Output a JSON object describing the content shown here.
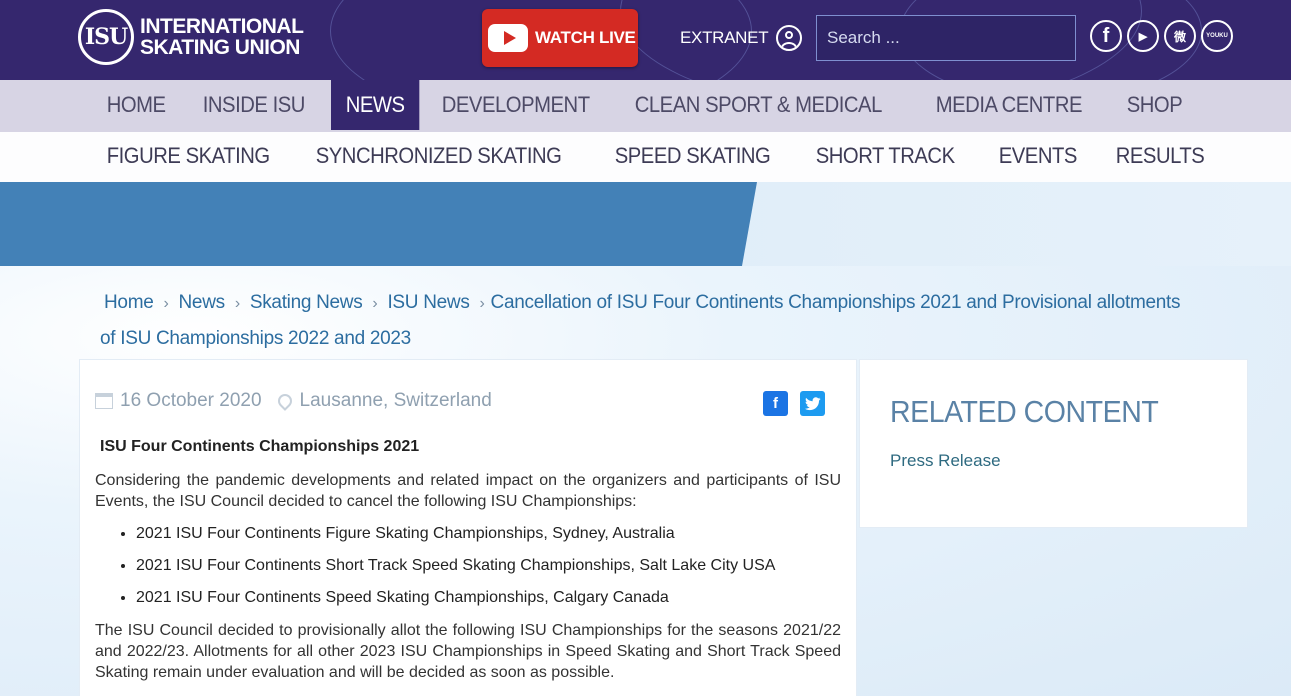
{
  "header": {
    "logo_mark": "ISU",
    "logo_line1": "INTERNATIONAL",
    "logo_line2": "SKATING UNION",
    "watch_live": "WATCH LIVE",
    "extranet": "EXTRANET",
    "search_placeholder": "Search ...",
    "social": [
      {
        "name": "facebook-icon",
        "glyph": "f"
      },
      {
        "name": "youtube-icon",
        "glyph": "▶"
      },
      {
        "name": "weibo-icon",
        "glyph": "微"
      },
      {
        "name": "youku-icon",
        "glyph": "YOUKU"
      }
    ]
  },
  "mainnav": [
    "HOME",
    "INSIDE ISU",
    "NEWS",
    "DEVELOPMENT",
    "CLEAN SPORT & MEDICAL",
    "MEDIA CENTRE",
    "SHOP"
  ],
  "mainnav_active": "NEWS",
  "subnav": [
    "FIGURE SKATING",
    "SYNCHRONIZED SKATING",
    "SPEED SKATING",
    "SHORT TRACK",
    "EVENTS",
    "RESULTS"
  ],
  "breadcrumb": {
    "items": [
      "Home",
      "News",
      "Skating News",
      "ISU News"
    ],
    "current": "Cancellation of ISU Four Continents Championships 2021 and Provisional allotments of ISU Championships 2022 and 2023"
  },
  "article": {
    "date": "16 October 2020",
    "location": "Lausanne, Switzerland",
    "share_facebook": "f",
    "share_twitter": "t",
    "heading": "ISU Four Continents Championships 2021",
    "intro": "Considering the pandemic developments and related impact on the organizers and participants of ISU Events, the ISU Council decided to cancel the following ISU Championships:",
    "events": [
      "2021 ISU Four Continents Figure Skating Championships, Sydney, Australia",
      "2021 ISU Four Continents Short Track Speed Skating Championships, Salt Lake City  USA",
      "2021 ISU Four Continents Speed Skating Championships, Calgary Canada"
    ],
    "allotment": "The ISU Council decided to provisionally allot the following ISU Championships for the seasons 2021/22 and 2022/23. Allotments for all other 2023 ISU Championships in Speed Skating and Short Track Speed Skating remain under evaluation and will be decided as soon as possible."
  },
  "related": {
    "title": "RELATED CONTENT",
    "link": "Press Release"
  },
  "colors": {
    "header_bg": "#35276e",
    "nav_bg": "#d7d4e4",
    "banner_blue": "#4381b7",
    "watch_live_red": "#d42a23",
    "link_blue": "#2c6da0"
  }
}
